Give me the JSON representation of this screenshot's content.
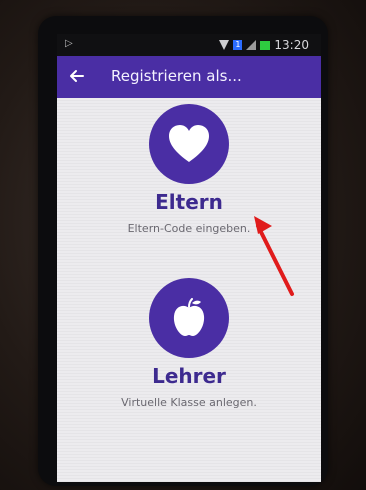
{
  "status_bar": {
    "time": "13:20",
    "notification_badge": "1"
  },
  "app_bar": {
    "title": "Registrieren als...",
    "back_icon": "arrow-left-icon"
  },
  "options": [
    {
      "icon": "heart-icon",
      "title": "Eltern",
      "subtitle": "Eltern-Code eingeben."
    },
    {
      "icon": "apple-icon",
      "title": "Lehrer",
      "subtitle": "Virtuelle Klasse anlegen."
    }
  ],
  "colors": {
    "primary": "#4a2ea4",
    "title_text": "#3d2a8f",
    "annotation_arrow": "#e01b1b"
  }
}
